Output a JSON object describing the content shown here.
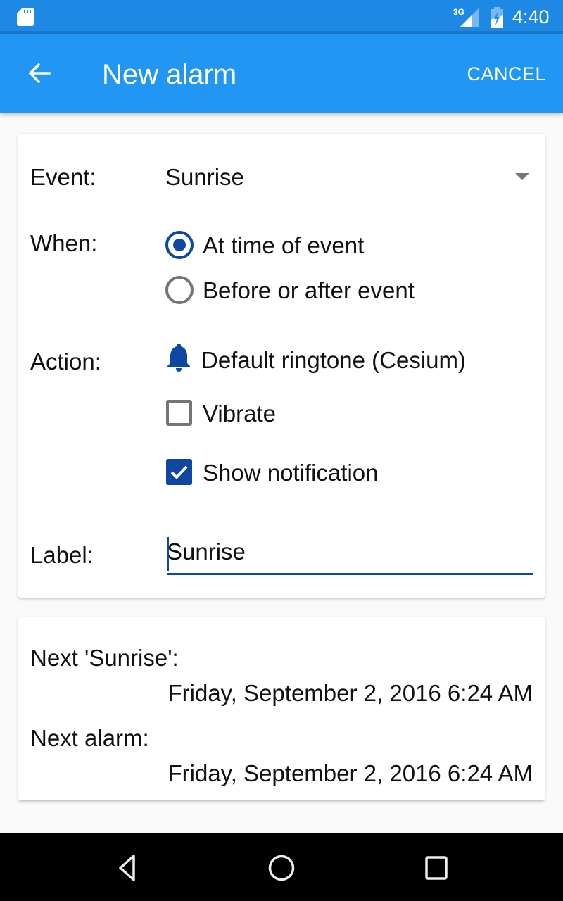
{
  "status_bar": {
    "time": "4:40",
    "icons": [
      "sd-card-icon",
      "signal-3g-icon",
      "battery-charging-icon"
    ],
    "network_label": "3G"
  },
  "app_bar": {
    "title": "New alarm",
    "back_icon": "arrow-back-icon",
    "cancel_label": "CANCEL"
  },
  "form": {
    "event": {
      "label": "Event:",
      "selected": "Sunrise"
    },
    "when": {
      "label": "When:",
      "options": [
        {
          "label": "At time of event",
          "selected": true
        },
        {
          "label": "Before or after event",
          "selected": false
        }
      ]
    },
    "action": {
      "label": "Action:",
      "ringtone": "Default ringtone (Cesium)",
      "vibrate": {
        "label": "Vibrate",
        "checked": false
      },
      "notification": {
        "label": "Show notification",
        "checked": true
      }
    },
    "label_field": {
      "label": "Label:",
      "value": "Sunrise"
    }
  },
  "info": {
    "next_event_title": "Next 'Sunrise':",
    "next_event_value": "Friday, September 2, 2016 6:24 AM",
    "next_alarm_title": "Next alarm:",
    "next_alarm_value": "Friday, September 2, 2016 6:24 AM"
  },
  "nav_bar": {
    "buttons": [
      "back-icon",
      "home-icon",
      "recents-icon"
    ]
  },
  "colors": {
    "status_bar": "#1e88e5",
    "app_bar": "#2196f3",
    "accent": "#0d47a1",
    "background": "#fafafa"
  }
}
